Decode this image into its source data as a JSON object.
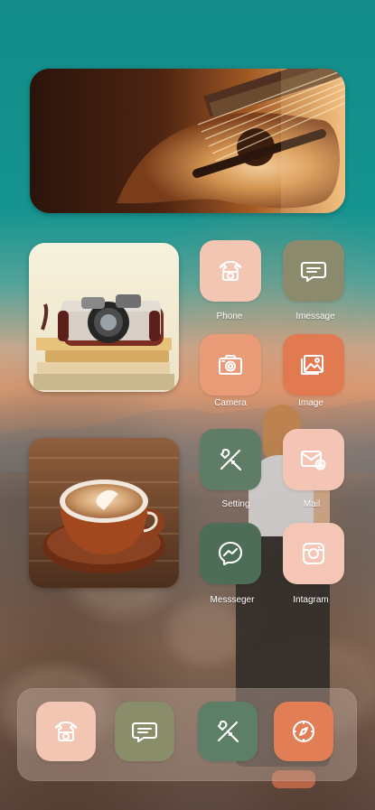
{
  "apps": {
    "phone": {
      "label": "Phone",
      "icon": "phone-icon",
      "color": "#f3c5b3"
    },
    "imessage": {
      "label": "Imessage",
      "icon": "message-icon",
      "color": "#8c8a6d"
    },
    "camera": {
      "label": "Camera",
      "icon": "camera-icon",
      "color": "#e99a77"
    },
    "image": {
      "label": "Image",
      "icon": "image-icon",
      "color": "#e17a50"
    },
    "setting": {
      "label": "Setting",
      "icon": "tools-icon",
      "color": "#5f7d66"
    },
    "mail": {
      "label": "Mail",
      "icon": "mail-icon",
      "color": "#f4c5b4"
    },
    "messenger": {
      "label": "Messseger",
      "icon": "messenger-icon",
      "color": "#4e6d56"
    },
    "instagram": {
      "label": "Intagram",
      "icon": "instagram-icon",
      "color": "#f5c6b5"
    }
  },
  "dock": {
    "items": [
      {
        "name": "phone",
        "icon": "phone-icon",
        "color": "#f3c5b3"
      },
      {
        "name": "imessage",
        "icon": "message-icon",
        "color": "#8a8d6a"
      },
      {
        "name": "setting",
        "icon": "tools-icon",
        "color": "#5d7e67"
      },
      {
        "name": "safari",
        "icon": "compass-icon",
        "color": "#e27e55"
      }
    ]
  },
  "widgets": {
    "guitar": {
      "icon": "guitar-photo"
    },
    "camera": {
      "icon": "vintage-camera-photo"
    },
    "coffee": {
      "icon": "coffee-photo"
    }
  }
}
